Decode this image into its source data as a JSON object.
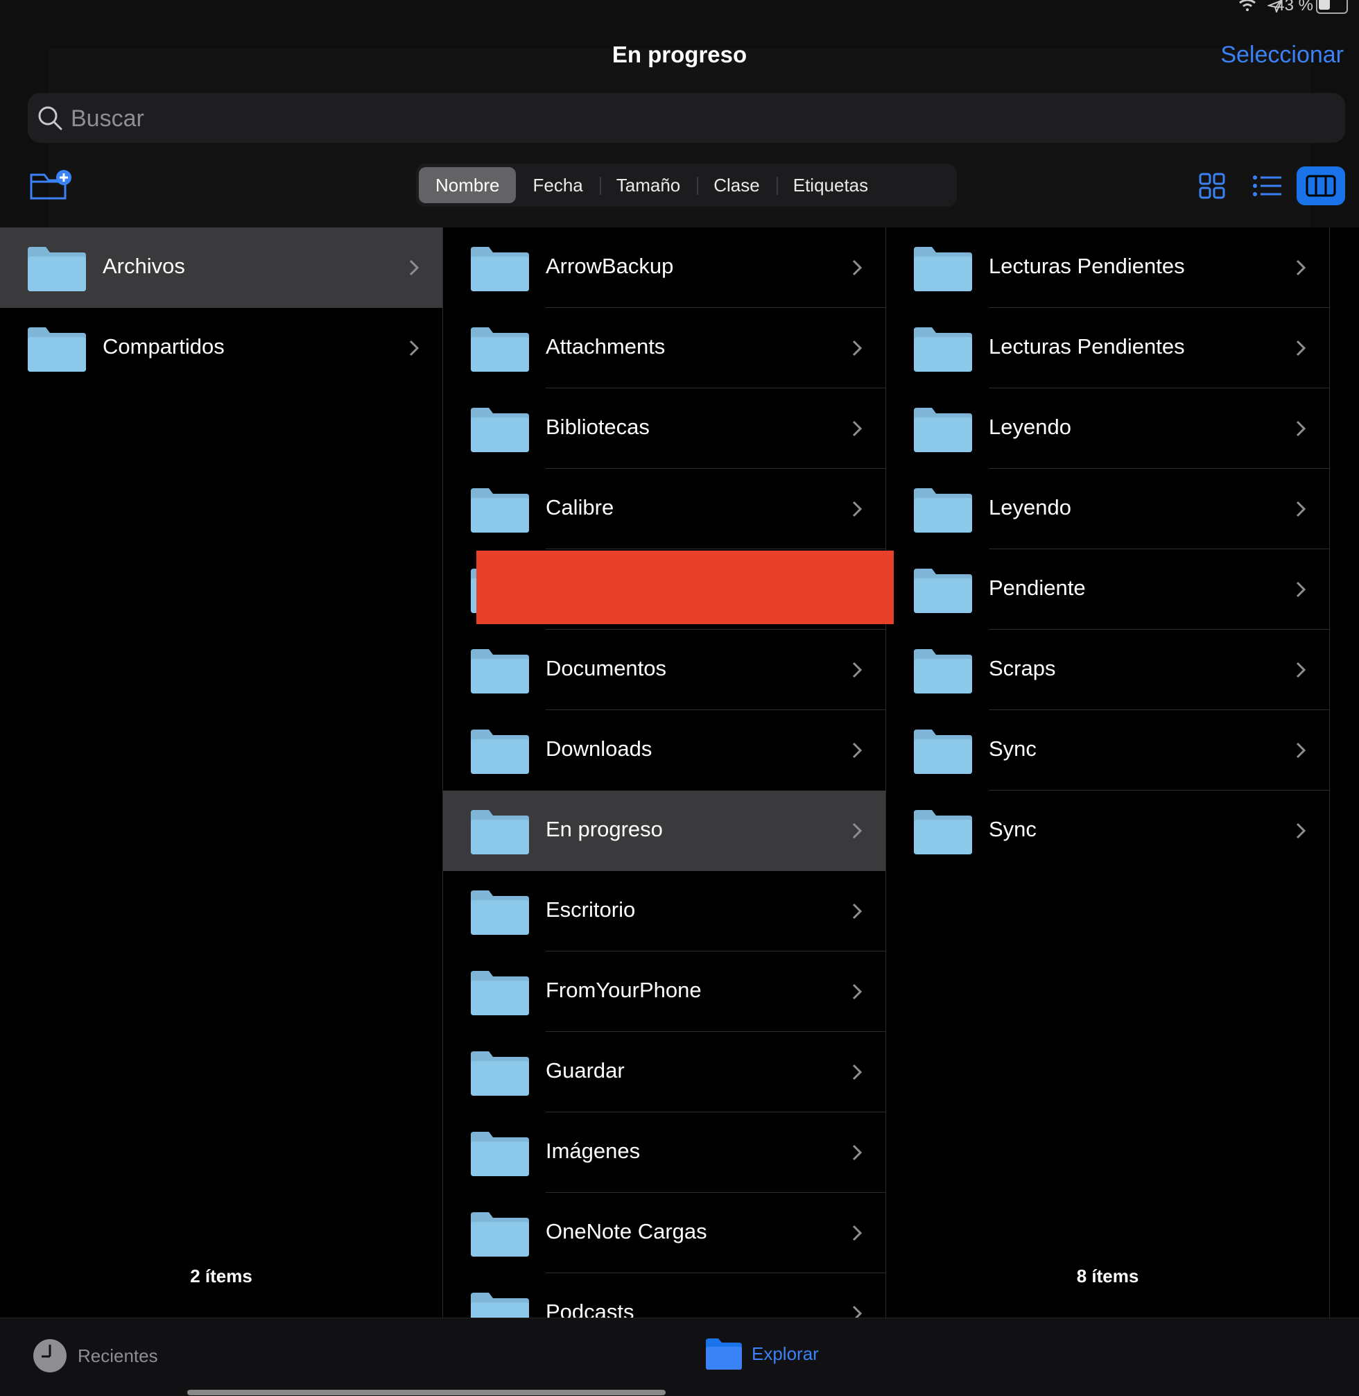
{
  "status_bar": {
    "battery_percent": "43 %"
  },
  "header": {
    "title": "En progreso",
    "select_label": "Seleccionar"
  },
  "search": {
    "placeholder": "Buscar"
  },
  "sort": {
    "options": [
      "Nombre",
      "Fecha",
      "Tamaño",
      "Clase",
      "Etiquetas"
    ],
    "active": "Nombre"
  },
  "colors": {
    "accent": "#3b82f6",
    "selected_row": "#3a3a3c",
    "redaction": "#e8412a",
    "folder": "#8cc8ea"
  },
  "column1": {
    "items": [
      {
        "label": "Archivos",
        "selected": true
      },
      {
        "label": "Compartidos",
        "selected": false
      }
    ],
    "count": "2 ítems"
  },
  "column2": {
    "items": [
      {
        "label": "ArrowBackup"
      },
      {
        "label": "Attachments"
      },
      {
        "label": "Bibliotecas"
      },
      {
        "label": "Calibre"
      },
      {
        "label": ""
      },
      {
        "label": "Documentos"
      },
      {
        "label": "Downloads"
      },
      {
        "label": "En progreso",
        "selected": true
      },
      {
        "label": "Escritorio"
      },
      {
        "label": "FromYourPhone"
      },
      {
        "label": "Guardar"
      },
      {
        "label": "Imágenes"
      },
      {
        "label": "OneNote Cargas"
      },
      {
        "label": "Podcasts"
      }
    ]
  },
  "column3": {
    "items": [
      {
        "label": "Lecturas Pendientes"
      },
      {
        "label": "Lecturas Pendientes"
      },
      {
        "label": "Leyendo"
      },
      {
        "label": "Leyendo"
      },
      {
        "label": "Pendiente"
      },
      {
        "label": "Scraps"
      },
      {
        "label": "Sync"
      },
      {
        "label": "Sync"
      }
    ],
    "count": "8 ítems"
  },
  "tabbar": {
    "recent_label": "Recientes",
    "explore_label": "Explorar"
  }
}
